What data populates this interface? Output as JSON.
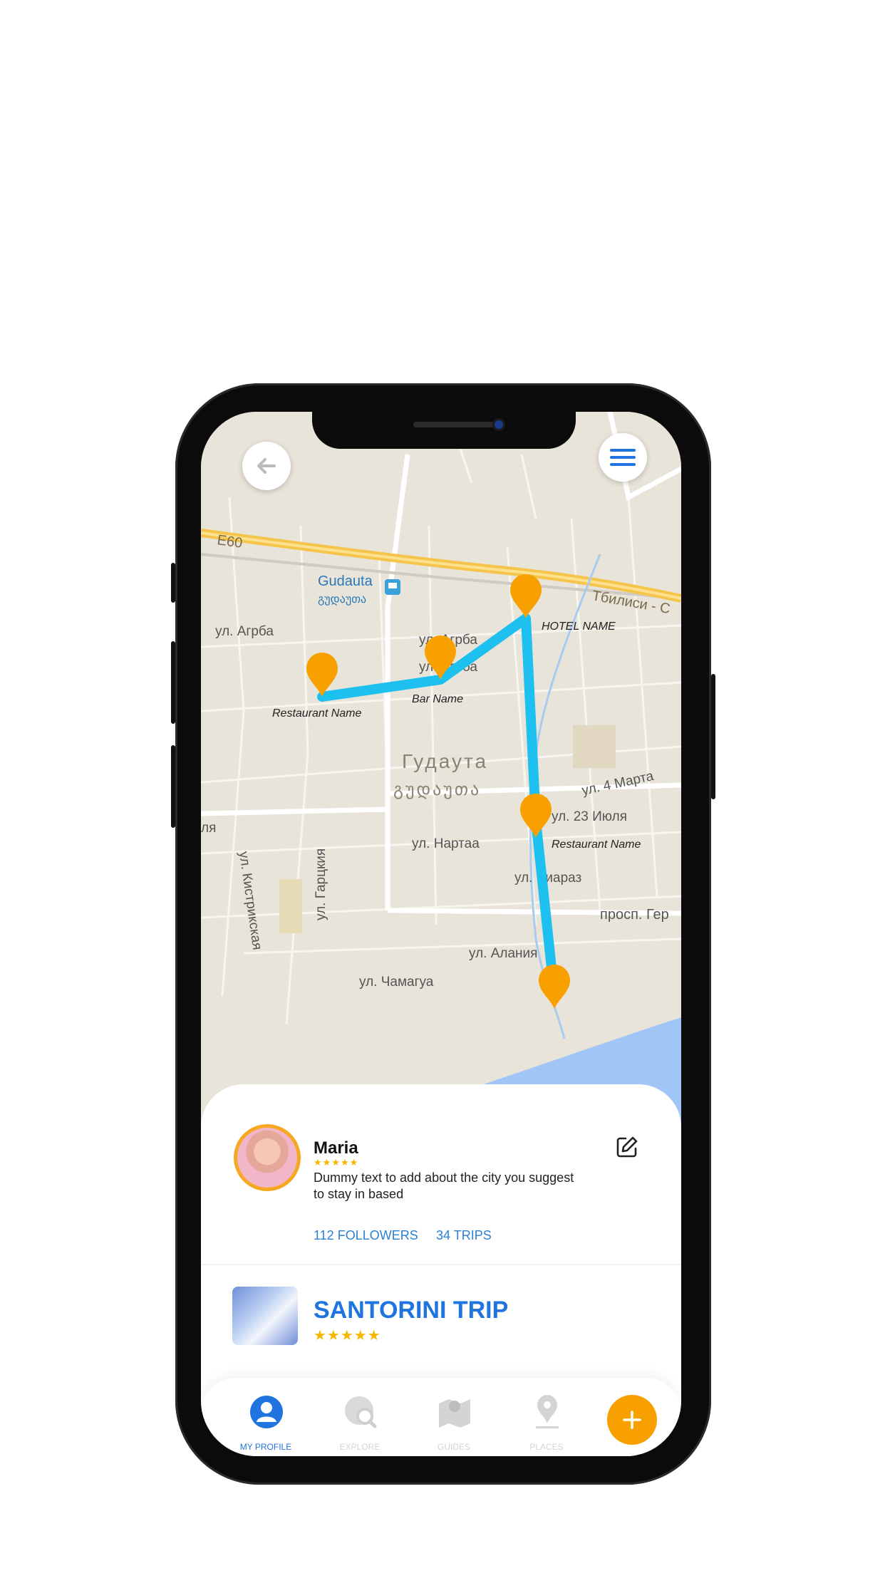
{
  "map": {
    "road_labels": [
      "E60",
      "Gudauta",
      "გუდაუთა",
      "ул. Агрба",
      "ул. Агрба",
      "ул. Агрба",
      "Гудаута",
      "გუდაუთა",
      "ул. 4 Марта",
      "ул. 23 Июля",
      "ул. Нартаа",
      "ул. Чиараз",
      "просп. Гер",
      "ул. Алания",
      "ул. Чамагуа",
      "ул. Гарцкия",
      "ул. Кистрикская",
      "Тбилиси - С",
      "ля"
    ],
    "pins": [
      {
        "label": "HOTEL NAME"
      },
      {
        "label": "Bar Name"
      },
      {
        "label": "Restaurant Name"
      },
      {
        "label": "Restaurant Name"
      },
      {
        "label": ""
      }
    ]
  },
  "header": {
    "back_icon": "arrow-left-icon",
    "menu_icon": "hamburger-menu-icon"
  },
  "profile": {
    "name": "Maria",
    "stars": "★★★★★",
    "bio": "Dummy text to add about the city you suggest to stay in based",
    "followers": "112 FOLLOWERS",
    "trips": "34 TRIPS",
    "edit_icon": "edit-icon"
  },
  "trip": {
    "title": "SANTORINI TRIP",
    "stars": "★★★★★"
  },
  "nav": {
    "items": [
      {
        "label": "MY PROFILE",
        "icon": "profile-icon",
        "active": true
      },
      {
        "label": "EXPLORE",
        "icon": "explore-icon",
        "active": false
      },
      {
        "label": "GUIDES",
        "icon": "map-guide-icon",
        "active": false
      },
      {
        "label": "PLACES",
        "icon": "place-pin-icon",
        "active": false
      }
    ],
    "fab_icon": "plus-icon"
  },
  "colors": {
    "accent": "#f7a000",
    "route": "#1ec0f0",
    "link": "#2a7fd6",
    "title": "#1f74e0"
  }
}
